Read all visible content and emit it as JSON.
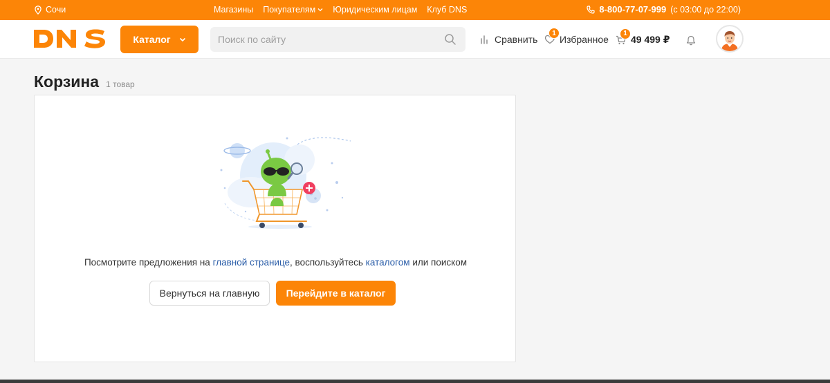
{
  "topbar": {
    "city": "Сочи",
    "links": [
      "Магазины",
      "Покупателям",
      "Юридическим лицам",
      "Клуб DNS"
    ],
    "phone": "8-800-77-07-999",
    "hours": "(с 03:00 до 22:00)"
  },
  "header": {
    "logo": "DNS",
    "catalog_label": "Каталог",
    "search_placeholder": "Поиск по сайту",
    "compare_label": "Сравнить",
    "favorites_label": "Избранное",
    "favorites_count": "1",
    "cart_count": "1",
    "cart_total": "49 499 ₽"
  },
  "page": {
    "title": "Корзина",
    "count": "1 товар"
  },
  "empty": {
    "text_before": "Посмотрите предложения на ",
    "link_home": "главной странице",
    "text_middle": ", воспользуйтесь ",
    "link_catalog": "каталогом",
    "text_after": " или поиском",
    "btn_home": "Вернуться на главную",
    "btn_catalog": "Перейдите в каталог"
  },
  "colors": {
    "brand": "#fc8507",
    "link": "#2a5da8"
  }
}
